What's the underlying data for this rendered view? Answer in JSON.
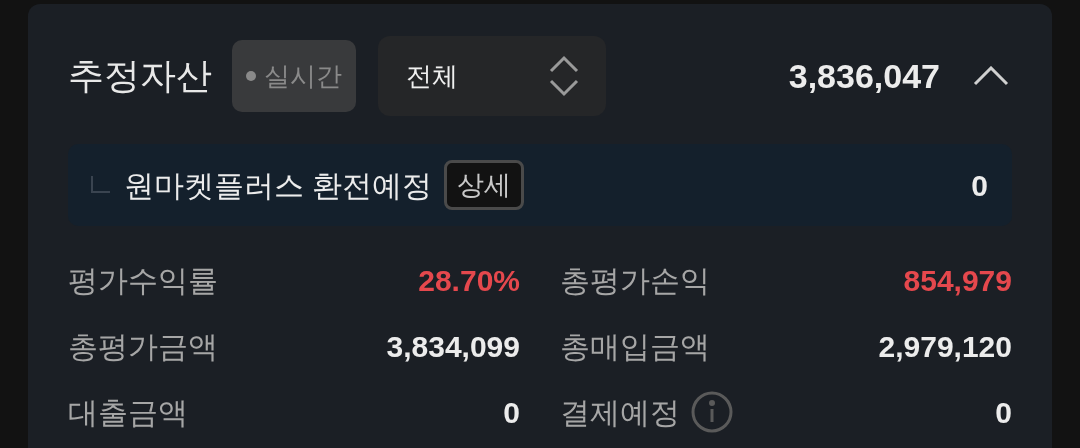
{
  "header": {
    "title": "추정자산",
    "live_badge": "실시간",
    "filter": {
      "value": "전체"
    },
    "total": "3,836,047",
    "expanded": true
  },
  "exchange": {
    "label": "원마켓플러스 환전예정",
    "detail_button": "상세",
    "value": "0"
  },
  "metrics": [
    {
      "label": "평가수익률",
      "value": "28.70%",
      "color": "#e5484d",
      "info": false
    },
    {
      "label": "총평가손익",
      "value": "854,979",
      "color": "#e5484d",
      "info": false
    },
    {
      "label": "총평가금액",
      "value": "3,834,099",
      "color": "#ececec",
      "info": false
    },
    {
      "label": "총매입금액",
      "value": "2,979,120",
      "color": "#ececec",
      "info": false
    },
    {
      "label": "대출금액",
      "value": "0",
      "color": "#ececec",
      "info": false
    },
    {
      "label": "결제예정",
      "value": "0",
      "color": "#ececec",
      "info": true
    }
  ]
}
